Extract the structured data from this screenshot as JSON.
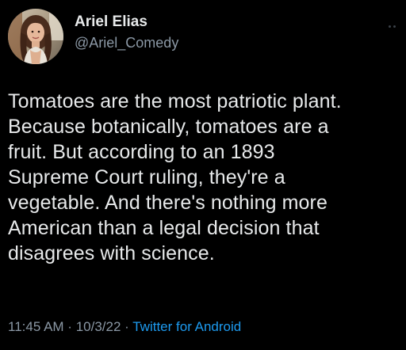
{
  "author": {
    "display_name": "Ariel Elias",
    "handle": "@Ariel_Comedy",
    "avatar_icon": "profile-photo"
  },
  "tweet": {
    "lines": [
      "Tomatoes are the most patriotic plant.",
      "Because botanically, tomatoes are a",
      "fruit. But according to an 1893",
      "Supreme Court ruling, they're a",
      "vegetable. And there's nothing more",
      "American than a legal decision that",
      "disagrees with science."
    ]
  },
  "meta": {
    "time": "11:45 AM",
    "separator": " · ",
    "date": "10/3/22",
    "source": "Twitter for Android"
  },
  "colors": {
    "background": "#000000",
    "text": "#e7e9ea",
    "muted": "#8b98a5",
    "link": "#1d9bf0"
  },
  "icons": {
    "more": "more-options-icon"
  }
}
